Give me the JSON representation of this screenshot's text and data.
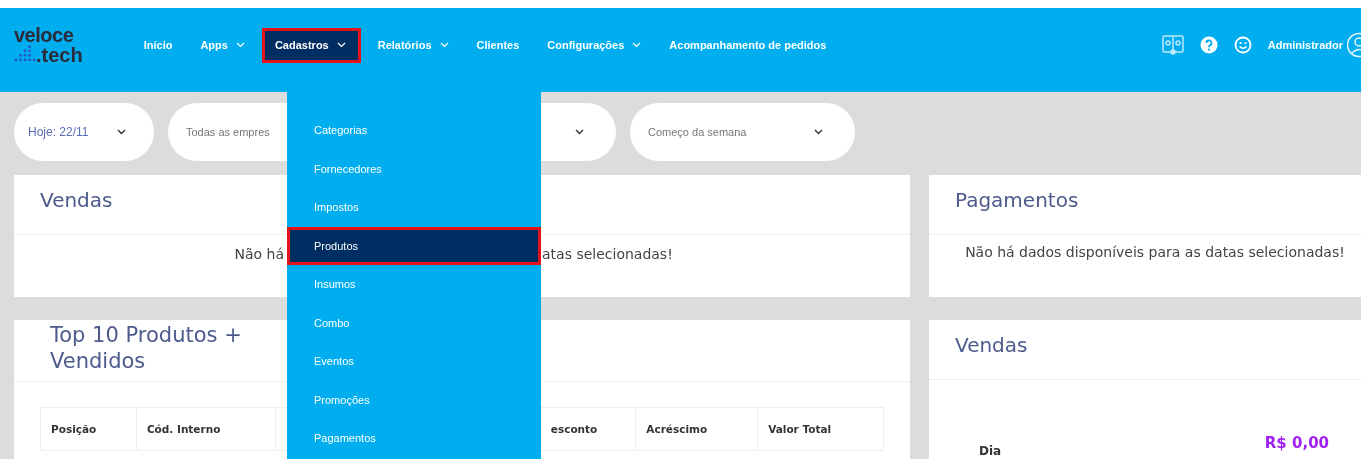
{
  "logo": {
    "line_1": "veloce",
    "line_2": ".tech"
  },
  "nav": [
    {
      "label": "Início",
      "dropdown": false,
      "selected": false
    },
    {
      "label": "Apps",
      "dropdown": true,
      "selected": false
    },
    {
      "label": "Cadastros",
      "dropdown": true,
      "selected": true
    },
    {
      "label": "Relatórios",
      "dropdown": true,
      "selected": false
    },
    {
      "label": "Clientes",
      "dropdown": false,
      "selected": false
    },
    {
      "label": "Configurações",
      "dropdown": true,
      "selected": false
    },
    {
      "label": "Acompanhamento de pedidos",
      "dropdown": false,
      "selected": false
    }
  ],
  "user": {
    "name": "Administrador"
  },
  "filters": [
    {
      "value": "Hoje: 22/11"
    },
    {
      "value": "Todas as empres"
    },
    {
      "value": "Começo da semana"
    }
  ],
  "sales_card": {
    "title": "Vendas",
    "message_left": "Não há",
    "message_right": "atas selecionadas!"
  },
  "payments_card": {
    "title": "Pagamentos",
    "message": "Não há dados disponíveis para as datas selecionadas!"
  },
  "top_products_card": {
    "title": "Top 10 Produtos + Vendidos",
    "columns": [
      "Posição",
      "Cód. Interno",
      "esconto",
      "Acréscimo",
      "Valor Total"
    ]
  },
  "sales_summary_card": {
    "title": "Vendas",
    "label": "Dia",
    "value": "R$ 0,00"
  },
  "dropdown_menu": [
    {
      "label": "Categorias",
      "selected": false
    },
    {
      "label": "Fornecedores",
      "selected": false
    },
    {
      "label": "Impostos",
      "selected": false
    },
    {
      "label": "Produtos",
      "selected": true
    },
    {
      "label": "Insumos",
      "selected": false
    },
    {
      "label": "Combo",
      "selected": false
    },
    {
      "label": "Eventos",
      "selected": false
    },
    {
      "label": "Promoções",
      "selected": false
    },
    {
      "label": "Pagamentos",
      "selected": false
    }
  ]
}
